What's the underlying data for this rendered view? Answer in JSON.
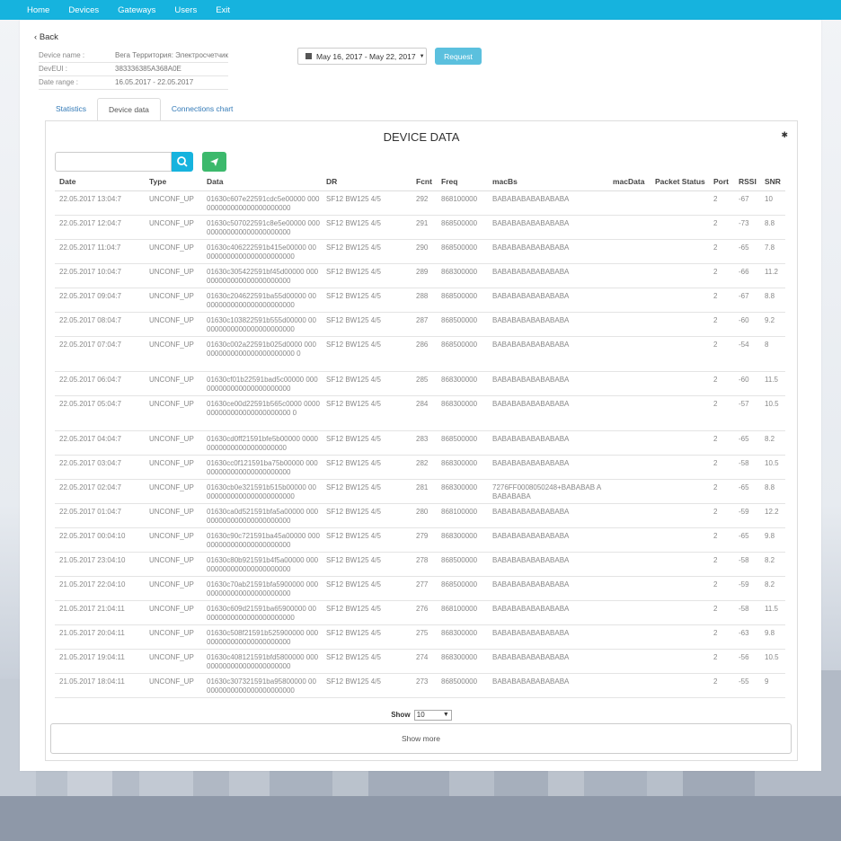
{
  "nav": [
    "Home",
    "Devices",
    "Gateways",
    "Users",
    "Exit"
  ],
  "back_label": "Back",
  "info": {
    "name_label": "Device name :",
    "name_value": "Вега Территория: Электросчетчик",
    "eui_label": "DevEUI :",
    "eui_value": "383336385A368A0E",
    "range_label": "Date range :",
    "range_value": "16.05.2017 - 22.05.2017"
  },
  "daterange_button": "May 16, 2017 - May 22, 2017",
  "request_button": "Request",
  "tabs": [
    "Statistics",
    "Device data",
    "Connections chart"
  ],
  "card_title": "DEVICE DATA",
  "columns": [
    "Date",
    "Type",
    "Data",
    "DR",
    "Fcnt",
    "Freq",
    "macBs",
    "macData",
    "Packet Status",
    "Port",
    "RSSI",
    "SNR"
  ],
  "rows": [
    {
      "date": "22.05.2017 13:04:7",
      "type": "UNCONF_UP",
      "data": "01630c607e22591cdc5e00000 000000000000000000000000",
      "dr": "SF12 BW125 4/5",
      "fcnt": "292",
      "freq": "868100000",
      "macbs": "BABABABABABABABA",
      "port": "2",
      "rssi": "-67",
      "snr": "10"
    },
    {
      "date": "22.05.2017 12:04:7",
      "type": "UNCONF_UP",
      "data": "01630c507022591c8e5e00000 000000000000000000000000",
      "dr": "SF12 BW125 4/5",
      "fcnt": "291",
      "freq": "868500000",
      "macbs": "BABABABABABABABA",
      "port": "2",
      "rssi": "-73",
      "snr": "8.8"
    },
    {
      "date": "22.05.2017 11:04:7",
      "type": "UNCONF_UP",
      "data": "01630c406222591b415e00000 000000000000000000000000",
      "dr": "SF12 BW125 4/5",
      "fcnt": "290",
      "freq": "868500000",
      "macbs": "BABABABABABABABA",
      "port": "2",
      "rssi": "-65",
      "snr": "7.8"
    },
    {
      "date": "22.05.2017 10:04:7",
      "type": "UNCONF_UP",
      "data": "01630c305422591bf45d00000 000000000000000000000000",
      "dr": "SF12 BW125 4/5",
      "fcnt": "289",
      "freq": "868300000",
      "macbs": "BABABABABABABABA",
      "port": "2",
      "rssi": "-66",
      "snr": "11.2"
    },
    {
      "date": "22.05.2017 09:04:7",
      "type": "UNCONF_UP",
      "data": "01630c204622591ba55d00000 000000000000000000000000",
      "dr": "SF12 BW125 4/5",
      "fcnt": "288",
      "freq": "868500000",
      "macbs": "BABABABABABABABA",
      "port": "2",
      "rssi": "-67",
      "snr": "8.8"
    },
    {
      "date": "22.05.2017 08:04:7",
      "type": "UNCONF_UP",
      "data": "01630c103822591b555d00000 000000000000000000000000",
      "dr": "SF12 BW125 4/5",
      "fcnt": "287",
      "freq": "868500000",
      "macbs": "BABABABABABABABA",
      "port": "2",
      "rssi": "-60",
      "snr": "9.2"
    },
    {
      "date": "22.05.2017 07:04:7",
      "type": "UNCONF_UP",
      "data": "01630c002a22591b025d0000 0000000000000000000000000 0",
      "dr": "SF12 BW125 4/5",
      "fcnt": "286",
      "freq": "868500000",
      "macbs": "BABABABABABABABA",
      "port": "2",
      "rssi": "-54",
      "snr": "8"
    },
    {
      "date": "22.05.2017 06:04:7",
      "type": "UNCONF_UP",
      "data": "01630cf01b22591bad5c00000 000000000000000000000000",
      "dr": "SF12 BW125 4/5",
      "fcnt": "285",
      "freq": "868300000",
      "macbs": "BABABABABABABABA",
      "port": "2",
      "rssi": "-60",
      "snr": "11.5"
    },
    {
      "date": "22.05.2017 05:04:7",
      "type": "UNCONF_UP",
      "data": "01630ce00d22591b565c0000 0000000000000000000000000 0",
      "dr": "SF12 BW125 4/5",
      "fcnt": "284",
      "freq": "868300000",
      "macbs": "BABABABABABABABA",
      "port": "2",
      "rssi": "-57",
      "snr": "10.5"
    },
    {
      "date": "22.05.2017 04:04:7",
      "type": "UNCONF_UP",
      "data": "01630cd0ff21591bfe5b00000 000000000000000000000000",
      "dr": "SF12 BW125 4/5",
      "fcnt": "283",
      "freq": "868500000",
      "macbs": "BABABABABABABABA",
      "port": "2",
      "rssi": "-65",
      "snr": "8.2"
    },
    {
      "date": "22.05.2017 03:04:7",
      "type": "UNCONF_UP",
      "data": "01630cc0f121591ba75b00000 000000000000000000000000",
      "dr": "SF12 BW125 4/5",
      "fcnt": "282",
      "freq": "868300000",
      "macbs": "BABABABABABABABA",
      "port": "2",
      "rssi": "-58",
      "snr": "10.5"
    },
    {
      "date": "22.05.2017 02:04:7",
      "type": "UNCONF_UP",
      "data": "01630cb0e321591b515b00000 000000000000000000000000",
      "dr": "SF12 BW125 4/5",
      "fcnt": "281",
      "freq": "868300000",
      "macbs": "7276FF0008050248+BABABAB ABABABABA",
      "port": "2",
      "rssi": "-65",
      "snr": "8.8"
    },
    {
      "date": "22.05.2017 01:04:7",
      "type": "UNCONF_UP",
      "data": "01630ca0d521591bfa5a00000 000000000000000000000000",
      "dr": "SF12 BW125 4/5",
      "fcnt": "280",
      "freq": "868100000",
      "macbs": "BABABABABABABABA",
      "port": "2",
      "rssi": "-59",
      "snr": "12.2"
    },
    {
      "date": "22.05.2017 00:04:10",
      "type": "UNCONF_UP",
      "data": "01630c90c721591ba45a00000 000000000000000000000000",
      "dr": "SF12 BW125 4/5",
      "fcnt": "279",
      "freq": "868300000",
      "macbs": "BABABABABABABABA",
      "port": "2",
      "rssi": "-65",
      "snr": "9.8"
    },
    {
      "date": "21.05.2017 23:04:10",
      "type": "UNCONF_UP",
      "data": "01630c80b921591b4f5a00000 000000000000000000000000",
      "dr": "SF12 BW125 4/5",
      "fcnt": "278",
      "freq": "868500000",
      "macbs": "BABABABABABABABA",
      "port": "2",
      "rssi": "-58",
      "snr": "8.2"
    },
    {
      "date": "21.05.2017 22:04:10",
      "type": "UNCONF_UP",
      "data": "01630c70ab21591bfa5900000 000000000000000000000000",
      "dr": "SF12 BW125 4/5",
      "fcnt": "277",
      "freq": "868500000",
      "macbs": "BABABABABABABABA",
      "port": "2",
      "rssi": "-59",
      "snr": "8.2"
    },
    {
      "date": "21.05.2017 21:04:11",
      "type": "UNCONF_UP",
      "data": "01630c609d21591ba65900000 000000000000000000000000",
      "dr": "SF12 BW125 4/5",
      "fcnt": "276",
      "freq": "868100000",
      "macbs": "BABABABABABABABA",
      "port": "2",
      "rssi": "-58",
      "snr": "11.5"
    },
    {
      "date": "21.05.2017 20:04:11",
      "type": "UNCONF_UP",
      "data": "01630c508f21591b525900000 000000000000000000000000",
      "dr": "SF12 BW125 4/5",
      "fcnt": "275",
      "freq": "868300000",
      "macbs": "BABABABABABABABA",
      "port": "2",
      "rssi": "-63",
      "snr": "9.8"
    },
    {
      "date": "21.05.2017 19:04:11",
      "type": "UNCONF_UP",
      "data": "01630c408121591bfd5800000 000000000000000000000000",
      "dr": "SF12 BW125 4/5",
      "fcnt": "274",
      "freq": "868300000",
      "macbs": "BABABABABABABABA",
      "port": "2",
      "rssi": "-56",
      "snr": "10.5"
    },
    {
      "date": "21.05.2017 18:04:11",
      "type": "UNCONF_UP",
      "data": "01630c307321591ba95800000 000000000000000000000000",
      "dr": "SF12 BW125 4/5",
      "fcnt": "273",
      "freq": "868500000",
      "macbs": "BABABABABABABABA",
      "port": "2",
      "rssi": "-55",
      "snr": "9"
    }
  ],
  "show_label": "Show",
  "show_value": "10",
  "show_more": "Show more",
  "icons": {
    "gear": "gear-icon",
    "search": "search-icon",
    "send": "send-icon",
    "calendar": "calendar-icon"
  },
  "colors": {
    "topbar": "#16b3de",
    "request": "#5bc0de",
    "send": "#3cb96c"
  }
}
